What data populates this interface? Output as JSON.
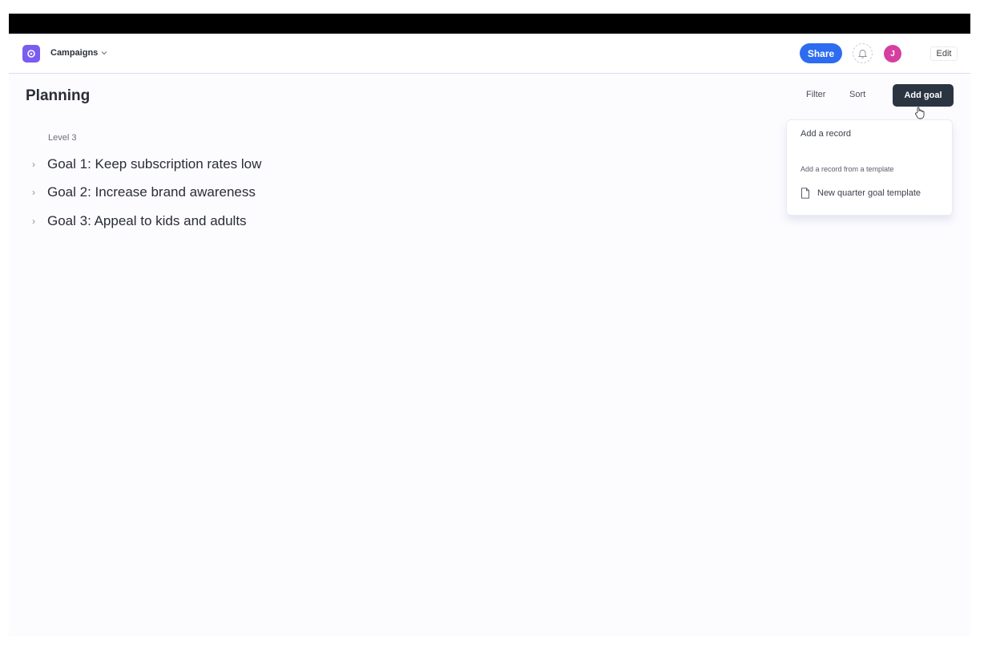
{
  "header": {
    "app_name": "Campaigns",
    "share_label": "Share",
    "avatar_initial": "J",
    "edit_label": "Edit",
    "colors": {
      "app_icon": "#7b5cf0",
      "share": "#2d6cf0",
      "avatar": "#d63fa0"
    }
  },
  "page": {
    "title": "Planning",
    "filter_label": "Filter",
    "sort_label": "Sort",
    "add_goal_label": "Add goal"
  },
  "group": {
    "label": "Level 3",
    "goals": [
      {
        "label": "Goal 1: Keep subscription rates low"
      },
      {
        "label": "Goal 2: Increase brand awareness"
      },
      {
        "label": "Goal 3: Appeal to kids and adults"
      }
    ]
  },
  "dropdown": {
    "add_record": "Add a record",
    "template_header": "Add a record from a template",
    "template_item": "New quarter goal template",
    "template_icon": "document-icon"
  }
}
